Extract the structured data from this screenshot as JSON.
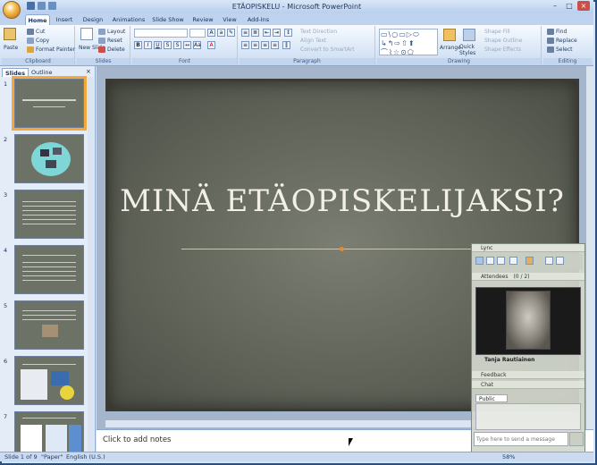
{
  "window": {
    "title": "ETÄOPISKELU - Microsoft PowerPoint"
  },
  "tabs": [
    "Home",
    "Insert",
    "Design",
    "Animations",
    "Slide Show",
    "Review",
    "View",
    "Add-Ins"
  ],
  "ribbon": {
    "clipboard": {
      "paste": "Paste",
      "cut": "Cut",
      "copy": "Copy",
      "format_painter": "Format Painter",
      "label": "Clipboard"
    },
    "slides": {
      "new_slide": "New Slide",
      "layout": "Layout",
      "reset": "Reset",
      "delete": "Delete",
      "label": "Slides"
    },
    "font": {
      "label": "Font"
    },
    "paragraph": {
      "text_direction": "Text Direction",
      "align_text": "Align Text",
      "convert": "Convert to SmartArt",
      "label": "Paragraph"
    },
    "drawing": {
      "arrange": "Arrange",
      "quick_styles": "Quick Styles",
      "shape_fill": "Shape Fill",
      "shape_outline": "Shape Outline",
      "shape_effects": "Shape Effects",
      "label": "Drawing"
    },
    "editing": {
      "find": "Find",
      "replace": "Replace",
      "select": "Select",
      "label": "Editing"
    }
  },
  "panel": {
    "tab_slides": "Slides",
    "tab_outline": "Outline",
    "slide_numbers": [
      "1",
      "2",
      "3",
      "4",
      "5",
      "6",
      "7"
    ]
  },
  "slide": {
    "title": "MINÄ ETÄOPISKELIJAKSI?"
  },
  "notes": {
    "placeholder": "Click to add notes"
  },
  "status": {
    "slide": "Slide 1 of 9",
    "theme": "\"Paper\"",
    "language": "English (U.S.)",
    "zoom": "58%"
  },
  "lync": {
    "title": "Lync",
    "attendees": "Attendees",
    "attendee_count": "(0 / 2)",
    "presenter": "Tanja Rautiainen",
    "feedback": "Feedback",
    "chat": "Chat",
    "tab_public": "Public",
    "message_placeholder": "Type here to send a message"
  },
  "colors": {
    "accent": "#f4a73b",
    "ribbon": "#dce8f7",
    "slide_bg": "#6c7265"
  }
}
